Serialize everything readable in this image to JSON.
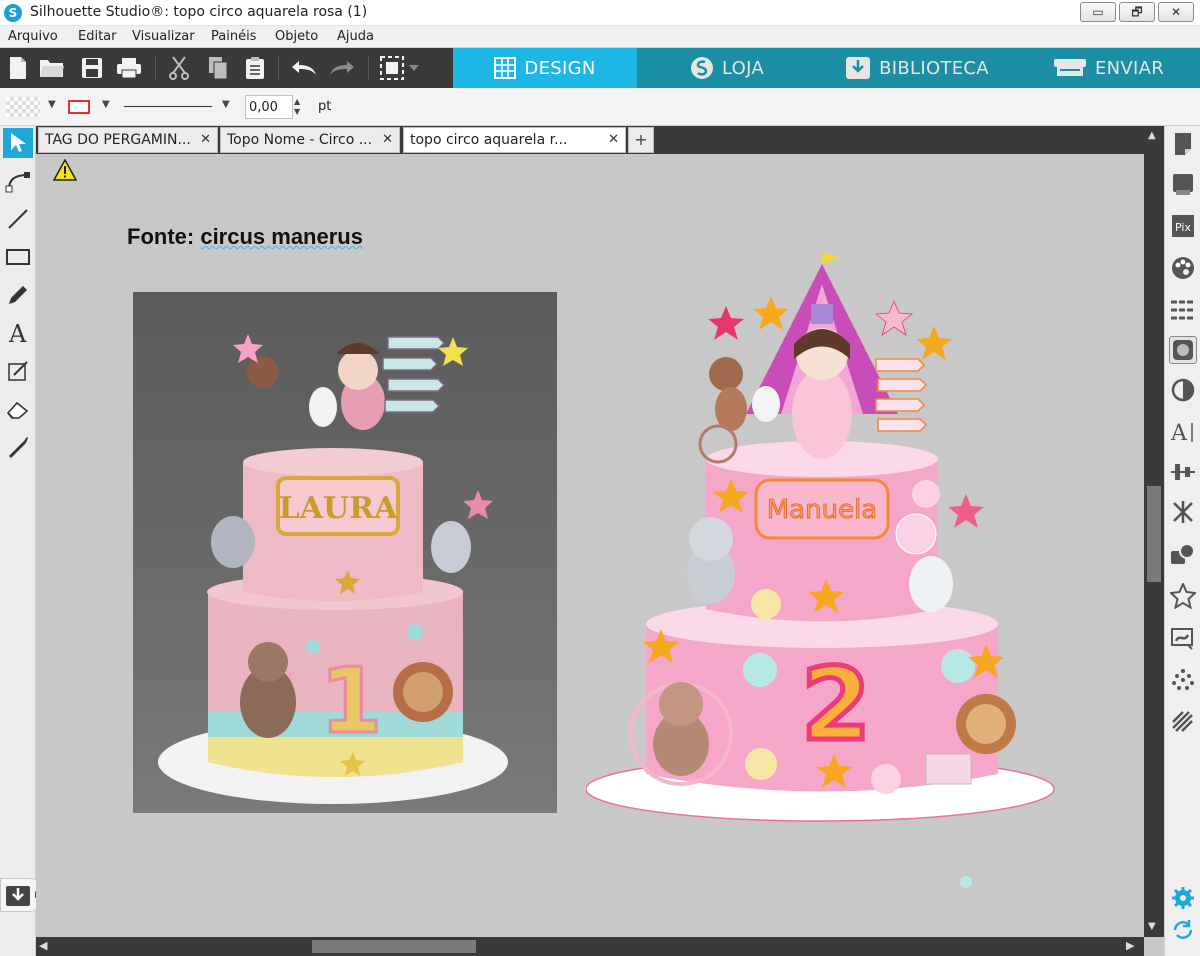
{
  "window": {
    "title": "Silhouette Studio®: topo circo aquarela rosa (1)",
    "logo_letter": "S",
    "controls": {
      "minimize": "▭",
      "maximize": "🗗",
      "close": "✕"
    }
  },
  "menu": [
    "Arquivo",
    "Editar",
    "Visualizar",
    "Painéis",
    "Objeto",
    "Ajuda"
  ],
  "toolbar": {
    "icons": [
      "new-file-icon",
      "open-folder-icon",
      "save-icon",
      "print-icon",
      "cut-icon",
      "copy-icon",
      "paste-icon",
      "undo-icon",
      "redo-icon",
      "select-page-icon"
    ],
    "modes": {
      "design": "DESIGN",
      "store": "LOJA",
      "library": "BIBLIOTECA",
      "send": "ENVIAR"
    }
  },
  "properties": {
    "line_width": "0,00",
    "unit": "pt",
    "line_color": "#e03030"
  },
  "tabs": [
    {
      "label": "TAG DO PERGAMIN...",
      "active": false
    },
    {
      "label": "Topo Nome - Circo ...",
      "active": false
    },
    {
      "label": "topo circo aquarela r...",
      "active": true
    }
  ],
  "tab_add": "+",
  "canvas": {
    "note_prefix": "Fonte: ",
    "note_font_name": "circus manerus",
    "photo": {
      "cake_name": "LAURA",
      "number": "1"
    },
    "design": {
      "cake_name": "Manuela",
      "number": "2"
    }
  },
  "right_panel_icons": [
    "page-setup-icon",
    "registration-marks-icon",
    "pixscan-icon",
    "fill-color-icon",
    "line-style-icon",
    "image-effects-icon",
    "transparency-icon",
    "text-style-icon",
    "align-icon",
    "replicate-icon",
    "modify-icon",
    "library-shapes-icon",
    "trace-icon",
    "rhinestone-icon",
    "sketch-icon",
    "settings-gear-icon",
    "refresh-icon"
  ],
  "colors": {
    "mode_active": "#1eb6e4",
    "mode_inactive": "#1c8ea3",
    "toolbar_bg": "#3a3a3a",
    "canvas_bg": "#c8c8c8",
    "cake_pink": "#f4a7c8"
  }
}
